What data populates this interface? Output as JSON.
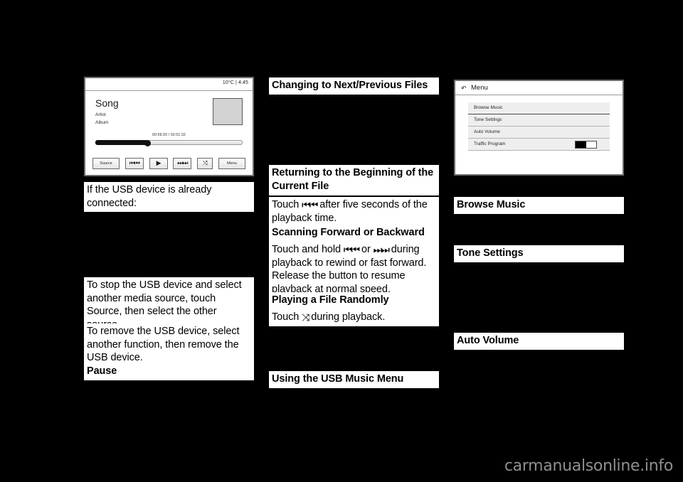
{
  "page": {
    "background": "#000000",
    "watermark": "carmanualsonline.info"
  },
  "player_screenshot": {
    "status_bar": "10°C | 4:45",
    "track_title": "Song",
    "artist": "Artist",
    "album": "Album",
    "elapsed_and_total": "00:09:20 / 02:01:32",
    "progress_percent": 36,
    "buttons": [
      {
        "label": "Source",
        "icon": "source-button"
      },
      {
        "label": "⏮⏮",
        "icon": "previous-track-icon"
      },
      {
        "label": "▶",
        "icon": "play-icon"
      },
      {
        "label": "⏭⏭",
        "icon": "next-track-icon"
      },
      {
        "label": "⤨",
        "icon": "shuffle-icon"
      },
      {
        "label": "Menu",
        "icon": "menu-button"
      }
    ]
  },
  "menu_screenshot": {
    "back_icon": "↶",
    "title": "Menu",
    "items": [
      {
        "label": "Browse Music",
        "control": "none"
      },
      {
        "label": "Tone Settings",
        "control": "none"
      },
      {
        "label": "Auto Volume",
        "control": "none"
      },
      {
        "label": "Traffic Program",
        "control": "toggle",
        "toggle_state": "on"
      }
    ]
  },
  "left_column": {
    "para_usb_connected": "If the USB device is already connected:",
    "para_stop_usb": "To stop the USB device and select another media source, touch Source, then select the other source.",
    "para_remove_usb": "To remove the USB device, select another function, then remove the USB device.",
    "heading_pause": "Pause"
  },
  "middle_column": {
    "heading_changing_files": "Changing to Next/Previous Files",
    "heading_returning_beginning": "Returning to the Beginning of the Current File",
    "para_returning_beginning_pre": "Touch ",
    "para_returning_beginning_post": " after five seconds of the playback time.",
    "heading_scanning": "Scanning Forward or Backward",
    "para_scanning_pre": "Touch and hold ",
    "para_scanning_mid": " or ",
    "para_scanning_post": " during playback to rewind or fast forward. Release the button to resume playback at normal speed.",
    "heading_random": "Playing a File Randomly",
    "para_random_pre": "Touch ",
    "para_random_post": " during playback.",
    "heading_usb_music_menu": "Using the USB Music Menu",
    "icons": {
      "rewind": "⏮⏮",
      "forward": "⏭⏭",
      "shuffle": "⤨"
    }
  },
  "right_column": {
    "heading_browse_music": "Browse Music",
    "heading_tone_settings": "Tone Settings",
    "heading_auto_volume": "Auto Volume"
  }
}
